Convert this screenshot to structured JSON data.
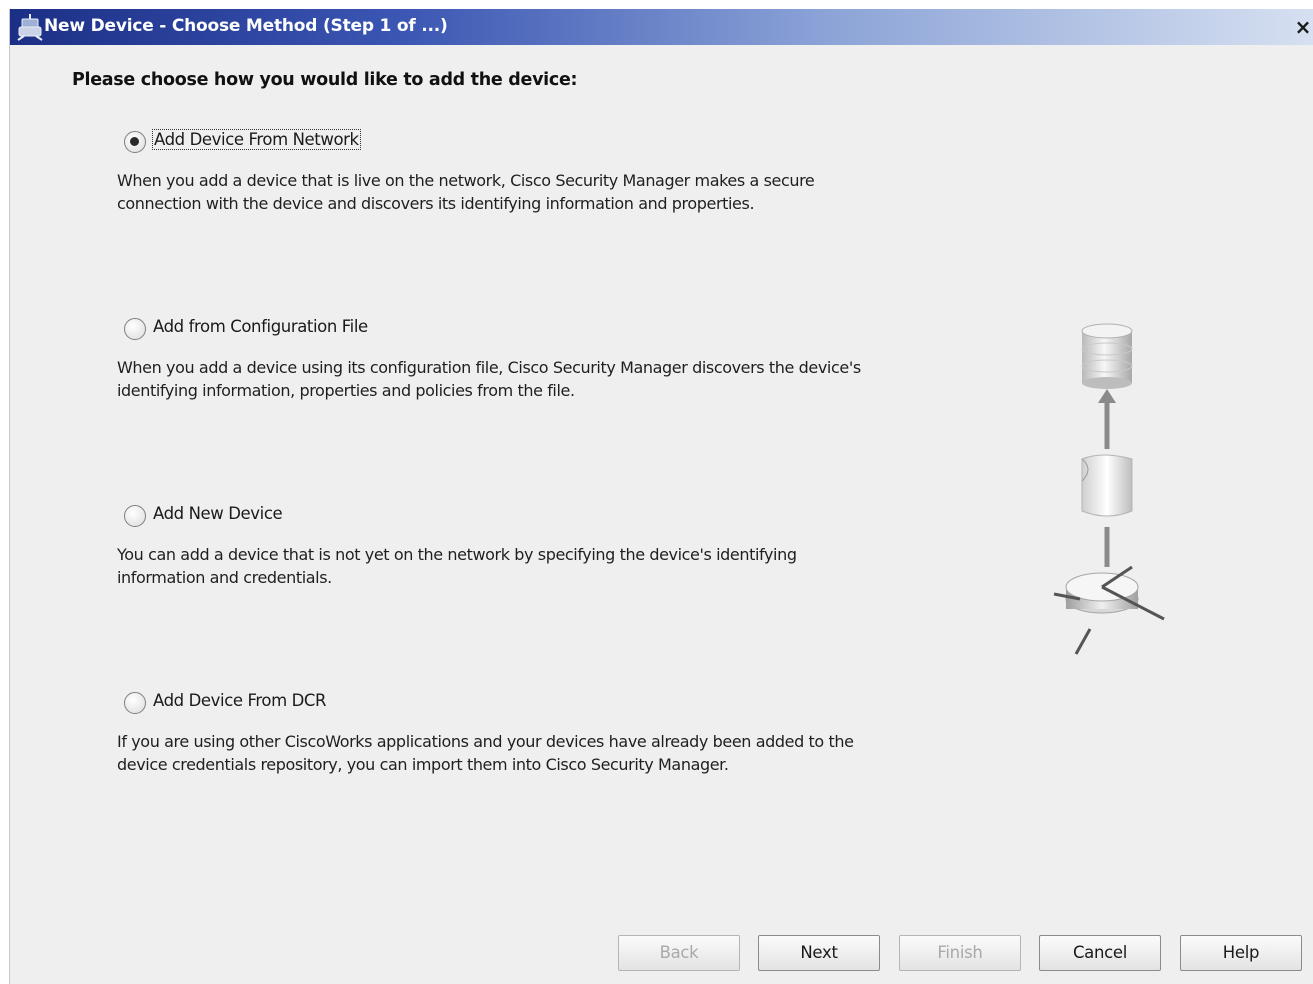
{
  "window": {
    "title": "New Device - Choose Method (Step 1 of ...)",
    "close_glyph": "×",
    "icon": "cisco-device-icon"
  },
  "prompt": "Please choose how you would like to add the device:",
  "options": [
    {
      "label": "Add Device From Network",
      "selected": true,
      "description": "When you add a device that is live on the network, Cisco Security Manager makes a secure connection with the device and discovers its identifying information and properties."
    },
    {
      "label": "Add from Configuration File",
      "selected": false,
      "description": "When you add a device using its configuration file, Cisco Security Manager discovers the device's identifying information, properties and policies from the file."
    },
    {
      "label": "Add New Device",
      "selected": false,
      "description": "You can add a device that is not yet on the network by specifying the device's identifying information and credentials."
    },
    {
      "label": "Add Device From DCR",
      "selected": false,
      "description": "If you are using other CiscoWorks applications and your devices have already been added to the device credentials repository, you can import them into Cisco Security Manager."
    }
  ],
  "buttons": {
    "back": {
      "label": "Back",
      "enabled": false
    },
    "next": {
      "label": "Next",
      "enabled": true
    },
    "finish": {
      "label": "Finish",
      "enabled": false
    },
    "cancel": {
      "label": "Cancel",
      "enabled": true
    },
    "help": {
      "label": "Help",
      "enabled": true
    }
  },
  "illustration": {
    "icons": [
      "database-icon",
      "config-file-icon",
      "router-icon"
    ]
  }
}
